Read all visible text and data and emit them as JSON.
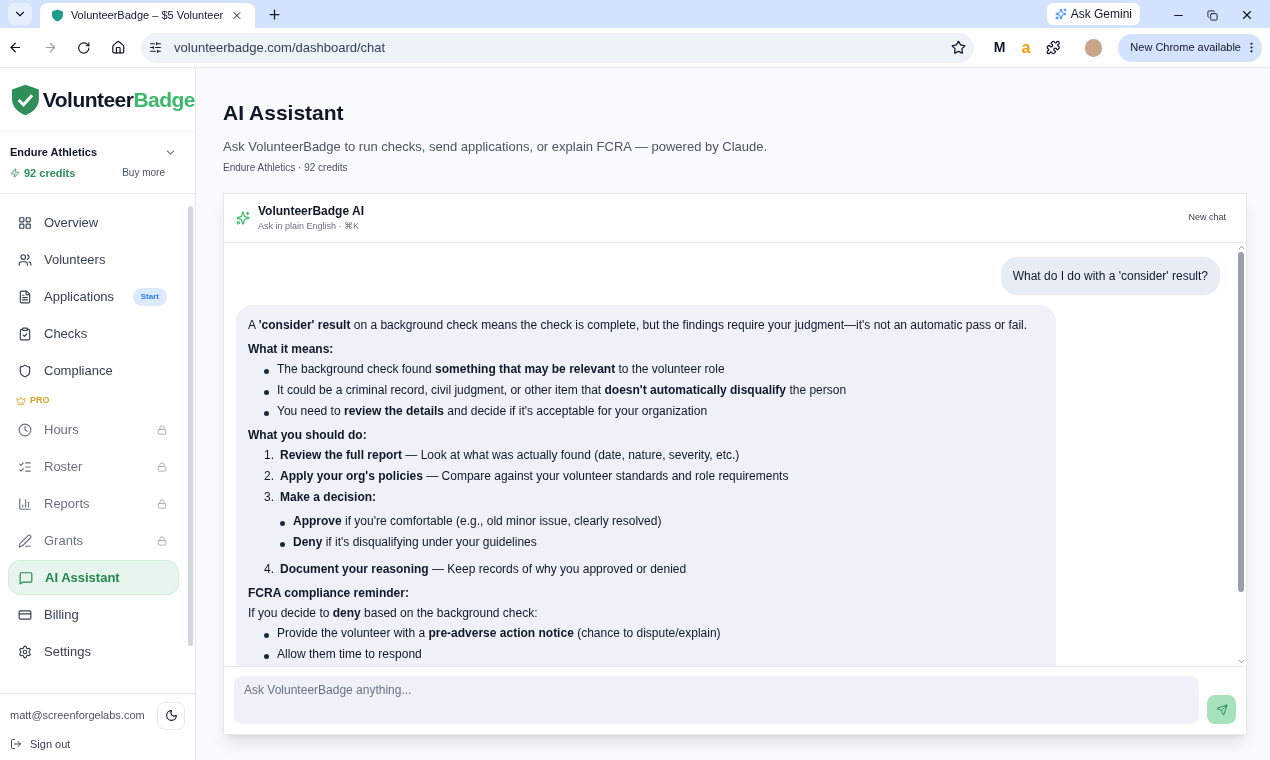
{
  "browser": {
    "tab_title": "VolunteerBadge – $5 Volunteer",
    "gemini": "Ask Gemini",
    "url": "volunteerbadge.com/dashboard/chat",
    "update": "New Chrome available",
    "extensions": [
      "M",
      "a"
    ]
  },
  "sidebar": {
    "logo": {
      "first": "Volunteer",
      "second": "Badge"
    },
    "org": "Endure Athletics",
    "credits": "92 credits",
    "buy": "Buy more",
    "items": [
      {
        "label": "Overview",
        "selected": false,
        "locked": false
      },
      {
        "label": "Volunteers",
        "selected": false,
        "locked": false
      },
      {
        "label": "Applications",
        "selected": false,
        "locked": false,
        "badge": "Start"
      },
      {
        "label": "Checks",
        "selected": false,
        "locked": false
      },
      {
        "label": "Compliance",
        "selected": false,
        "locked": false
      },
      {
        "label": "PRO",
        "kind": "section"
      },
      {
        "label": "Hours",
        "selected": false,
        "locked": true
      },
      {
        "label": "Roster",
        "selected": false,
        "locked": true
      },
      {
        "label": "Reports",
        "selected": false,
        "locked": true
      },
      {
        "label": "Grants",
        "selected": false,
        "locked": true
      },
      {
        "label": "AI Assistant",
        "selected": true,
        "locked": false
      },
      {
        "label": "Billing",
        "selected": false,
        "locked": false
      },
      {
        "label": "Settings",
        "selected": false,
        "locked": false
      }
    ],
    "email": "matt@screenforgelabs.com",
    "signout": "Sign out"
  },
  "page": {
    "title": "AI Assistant",
    "subtitle": "Ask VolunteerBadge to run checks, send applications, or explain FCRA — powered by Claude.",
    "meta": "Endure Athletics · 92 credits"
  },
  "chat": {
    "title": "VolunteerBadge AI",
    "hint": "Ask in plain English · ⌘K",
    "new_chat": "New chat",
    "user_message": "What do I do with a 'consider' result?",
    "reply": [
      {
        "kind": "paragraph",
        "text": "A **'consider' result** on a background check means the check is complete, but the findings require your judgment—it's not an automatic pass or fail."
      },
      {
        "kind": "heading",
        "text": "What it means:"
      },
      {
        "kind": "bullets",
        "items": [
          {
            "text": "The background check found **something that may be relevant** to the volunteer role"
          },
          {
            "text": "It could be a criminal record, civil judgment, or other item that **doesn't automatically disqualify** the person"
          },
          {
            "text": "You need to **review the details** and decide if it's acceptable for your organization"
          }
        ]
      },
      {
        "kind": "heading",
        "text": "What you should do:"
      },
      {
        "kind": "numbered",
        "items": [
          {
            "number": "1.",
            "text": "**Review the full report** — Look at what was actually found (date, nature, severity, etc.)"
          },
          {
            "number": "2.",
            "text": "**Apply your org's policies** — Compare against your volunteer standards and role requirements"
          },
          {
            "number": "3.",
            "text": "**Make a decision:**",
            "children": [
              {
                "text": "**Approve** if you're comfortable (e.g., old minor issue, clearly resolved)"
              },
              {
                "text": "**Deny** if it's disqualifying under your guidelines"
              }
            ]
          },
          {
            "number": "4.",
            "text": "**Document your reasoning** — Keep records of why you approved or denied"
          }
        ]
      },
      {
        "kind": "heading",
        "text": "FCRA compliance reminder:"
      },
      {
        "kind": "paragraph",
        "text": "If you decide to **deny** based on the background check:"
      },
      {
        "kind": "bullets",
        "items": [
          {
            "text": "Provide the volunteer with a **pre-adverse action notice** (chance to dispute/explain)"
          },
          {
            "text": "Allow them time to respond"
          }
        ]
      }
    ],
    "input_placeholder": "Ask VolunteerBadge anything..."
  }
}
